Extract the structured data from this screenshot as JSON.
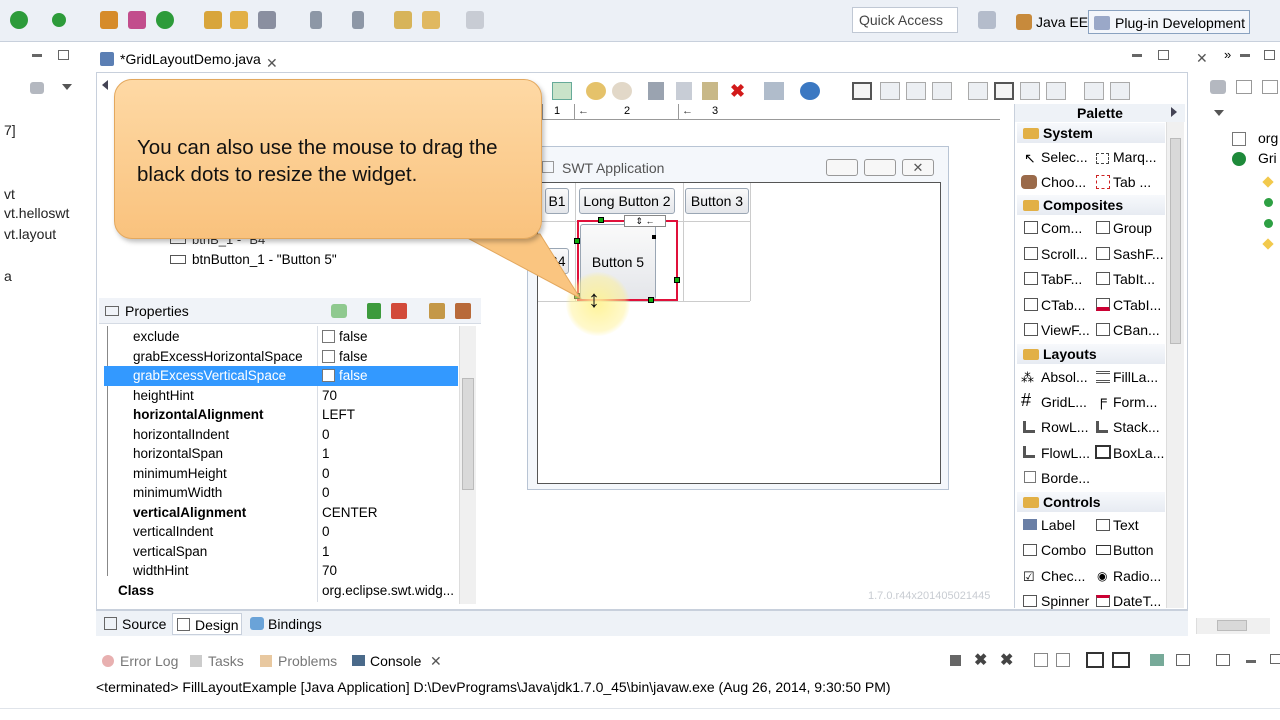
{
  "toolbar": {
    "quick_access": "Quick Access",
    "perspectives": [
      "Java EE",
      "Plug-in Development"
    ]
  },
  "left_panel": {
    "items": [
      "7]",
      "vt",
      "vt.helloswt",
      "vt.layout",
      "a"
    ]
  },
  "editor": {
    "tab_title": "*GridLayoutDemo.java",
    "tree_items": [
      "btnB_1 - \"B4\"",
      "btnButton_1 - \"Button 5\""
    ],
    "bottom_tabs": [
      "Source",
      "Design",
      "Bindings"
    ]
  },
  "properties": {
    "title": "Properties",
    "rows": [
      {
        "key": "exclude",
        "value": "false",
        "checkbox": true
      },
      {
        "key": "grabExcessHorizontalSpace",
        "value": "false",
        "checkbox": true
      },
      {
        "key": "grabExcessVerticalSpace",
        "value": "false",
        "checkbox": true
      },
      {
        "key": "heightHint",
        "value": "70"
      },
      {
        "key": "horizontalAlignment",
        "value": "LEFT"
      },
      {
        "key": "horizontalIndent",
        "value": "0"
      },
      {
        "key": "horizontalSpan",
        "value": "1"
      },
      {
        "key": "minimumHeight",
        "value": "0"
      },
      {
        "key": "minimumWidth",
        "value": "0"
      },
      {
        "key": "verticalAlignment",
        "value": "CENTER"
      },
      {
        "key": "verticalIndent",
        "value": "0"
      },
      {
        "key": "verticalSpan",
        "value": "1"
      },
      {
        "key": "widthHint",
        "value": "70"
      },
      {
        "key": "Class",
        "value": "org.eclipse.swt.widg..."
      }
    ]
  },
  "ruler": {
    "labels": [
      "1",
      "2",
      "3"
    ]
  },
  "swt_app": {
    "title": "SWT Application",
    "buttons": [
      "B1",
      "Long Button 2",
      "Button 3",
      "B4",
      "Button 5"
    ]
  },
  "callout": {
    "text": "You can also use the mouse to drag the black dots to resize the widget."
  },
  "palette": {
    "title": "Palette",
    "categories": {
      "system": "System",
      "composites": "Composites",
      "layouts": "Layouts",
      "controls": "Controls"
    },
    "system_items": [
      "Selec...",
      "Marq...",
      "Choo...",
      "Tab ..."
    ],
    "composite_items": [
      "Com...",
      "Group",
      "Scroll...",
      "SashF...",
      "TabF...",
      "TabIt...",
      "CTab...",
      "CTabI...",
      "ViewF...",
      "CBan..."
    ],
    "layout_items": [
      "Absol...",
      "FillLa...",
      "GridL...",
      "Form...",
      "RowL...",
      "Stack...",
      "FlowL...",
      "BoxLa...",
      "Borde..."
    ],
    "control_items": [
      "Label",
      "Text",
      "Combo",
      "Button",
      "Chec...",
      "Radio...",
      "Spinner",
      "DateT..."
    ]
  },
  "right_panel": {
    "items": [
      "org",
      "Gri"
    ]
  },
  "version": "1.7.0.r44x201405021445",
  "console": {
    "tabs": [
      "Error Log",
      "Tasks",
      "Problems",
      "Console"
    ],
    "text": "<terminated> FillLayoutExample [Java Application] D:\\DevPrograms\\Java\\jdk1.7.0_45\\bin\\javaw.exe (Aug 26, 2014, 9:30:50 PM)"
  },
  "colors": {
    "selection": "#3399ff",
    "callout": "#f9c27d",
    "handle": "#11aa11",
    "selected_widget_border": "#e0103a"
  }
}
